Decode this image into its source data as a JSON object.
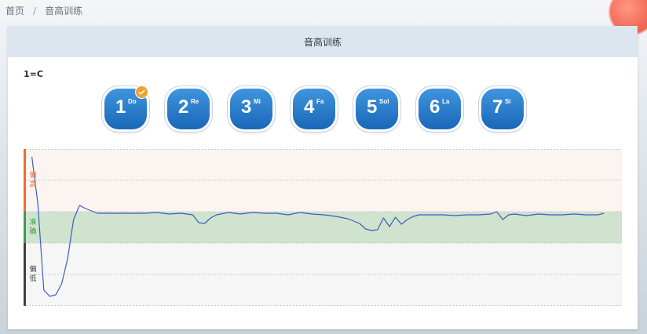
{
  "breadcrumb": {
    "home": "首页",
    "separator": "/",
    "current": "音高训练"
  },
  "header": {
    "title": "音高训练"
  },
  "key": {
    "label": "1=C"
  },
  "notes": [
    {
      "num": "1",
      "solfege": "Do",
      "selected": true
    },
    {
      "num": "2",
      "solfege": "Re",
      "selected": false
    },
    {
      "num": "3",
      "solfege": "Mi",
      "selected": false
    },
    {
      "num": "4",
      "solfege": "Fa",
      "selected": false
    },
    {
      "num": "5",
      "solfege": "Sol",
      "selected": false
    },
    {
      "num": "6",
      "solfege": "La",
      "selected": false
    },
    {
      "num": "7",
      "solfege": "Si",
      "selected": false
    }
  ],
  "pitch_chart": {
    "bands": {
      "high": "偏高",
      "accurate": "准确",
      "low": "偏低"
    },
    "colors": {
      "high_bar": "#f26b34",
      "high_bg": "#fbf4f1",
      "accurate_bar": "#3e9b4a",
      "accurate_bg": "#cfe3cf",
      "low_bar": "#404040",
      "low_bg": "#f6f6f6",
      "line": "#3b5fbf",
      "badge": "#f0a030",
      "button": "#2a7dcd"
    }
  },
  "chart_data": {
    "type": "line",
    "title": "",
    "xlabel": "",
    "ylabel": "",
    "xlim": [
      0,
      100
    ],
    "ylim": [
      -100,
      100
    ],
    "grid": true,
    "bands": [
      {
        "name": "偏高",
        "range": [
          20,
          100
        ]
      },
      {
        "name": "准确",
        "range": [
          -20,
          20
        ]
      },
      {
        "name": "偏低",
        "range": [
          -100,
          -20
        ]
      }
    ],
    "series": [
      {
        "x": [
          1,
          2,
          3,
          4,
          5,
          6,
          7,
          8,
          9,
          10,
          12,
          14,
          16,
          18,
          20,
          22,
          24,
          26,
          28,
          29,
          30,
          31,
          32,
          34,
          36,
          38,
          40,
          42,
          44,
          46,
          48,
          50,
          52,
          54,
          56,
          57,
          58,
          59,
          60,
          61,
          62,
          63,
          64,
          65,
          66,
          68,
          70,
          72,
          74,
          76,
          78,
          79,
          80,
          81,
          82,
          84,
          86,
          88,
          90,
          92,
          94,
          96,
          97
        ],
        "y": [
          90,
          30,
          -80,
          -88,
          -86,
          -72,
          -40,
          10,
          28,
          24,
          18,
          18,
          18,
          18,
          18,
          19,
          17,
          18,
          16,
          6,
          5,
          12,
          16,
          19,
          17,
          19,
          18,
          18,
          16,
          19,
          17,
          16,
          14,
          11,
          5,
          -2,
          -4,
          -3,
          12,
          1,
          13,
          4,
          10,
          14,
          16,
          16,
          16,
          15,
          16,
          16,
          17,
          20,
          10,
          16,
          17,
          15,
          17,
          16,
          16,
          17,
          16,
          16,
          18
        ]
      }
    ]
  }
}
